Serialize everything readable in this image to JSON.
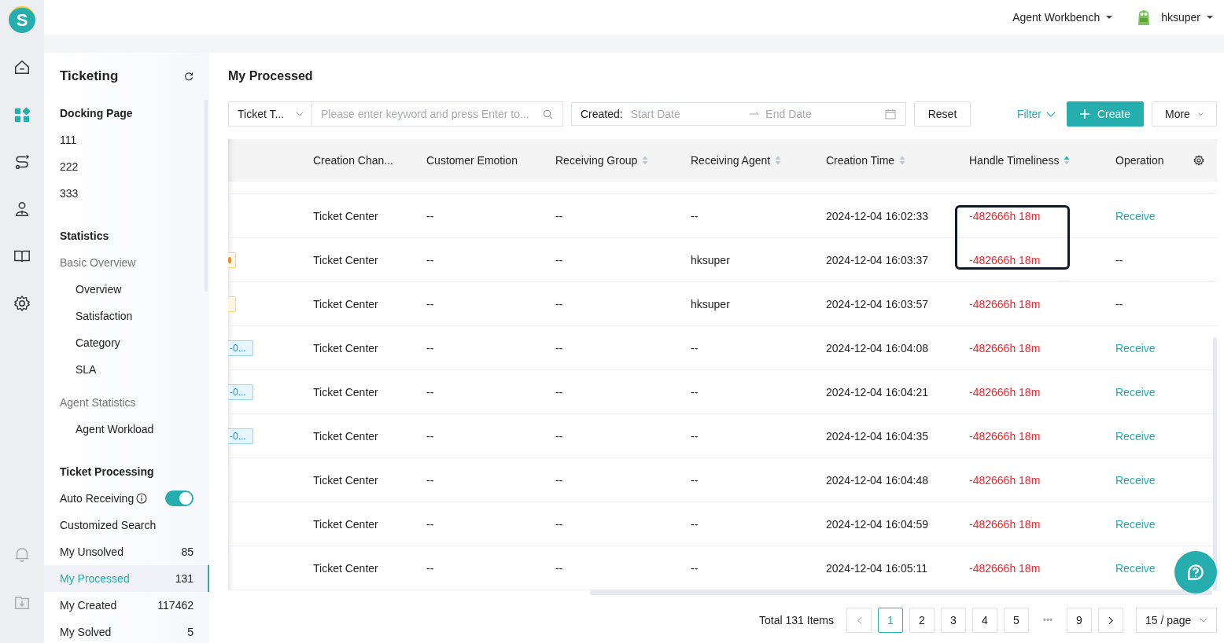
{
  "logo": "S",
  "rail": [
    {
      "kind": "home",
      "selected": false
    },
    {
      "kind": "grid",
      "selected": true
    },
    {
      "kind": "route",
      "selected": false
    },
    {
      "kind": "person",
      "selected": false
    },
    {
      "kind": "book",
      "selected": false
    },
    {
      "kind": "gear",
      "selected": false
    }
  ],
  "rail_bottom": [
    {
      "kind": "bell"
    },
    {
      "kind": "download"
    }
  ],
  "topbar": {
    "workspace": "Agent Workbench",
    "user": "hksuper"
  },
  "sidebar": {
    "title": "Ticketing",
    "sections": [
      {
        "heading": "Docking Page",
        "items": [
          {
            "label": "111",
            "kind": "item"
          },
          {
            "label": "222",
            "kind": "item"
          },
          {
            "label": "333",
            "kind": "item"
          }
        ]
      },
      {
        "heading": "Statistics",
        "items": [
          {
            "label": "Basic Overview",
            "kind": "group"
          },
          {
            "label": "Overview",
            "kind": "sub"
          },
          {
            "label": "Satisfaction",
            "kind": "sub"
          },
          {
            "label": "Category",
            "kind": "sub"
          },
          {
            "label": "SLA",
            "kind": "sub"
          },
          {
            "label": "Agent Statistics",
            "kind": "group"
          },
          {
            "label": "Agent Workload",
            "kind": "sub"
          }
        ]
      },
      {
        "heading": "Ticket Processing",
        "items": [
          {
            "label": "Auto Receiving",
            "kind": "toggle",
            "on": true
          },
          {
            "label": "Customized Search",
            "kind": "item"
          },
          {
            "label": "My Unsolved",
            "kind": "count",
            "count": "85",
            "selected": false
          },
          {
            "label": "My Processed",
            "kind": "count",
            "count": "131",
            "selected": true
          },
          {
            "label": "My Created",
            "kind": "count",
            "count": "117462",
            "selected": false
          },
          {
            "label": "My Solved",
            "kind": "count",
            "count": "5",
            "selected": false
          }
        ]
      }
    ]
  },
  "page_title": "My Processed",
  "filters": {
    "type_select": "Ticket T...",
    "search": {
      "placeholder": "Please enter keyword and press Enter to..."
    },
    "date_label": "Created:",
    "start_placeholder": "Start Date",
    "end_placeholder": "End Date",
    "reset": "Reset",
    "filter": "Filter",
    "create": "Create",
    "more": "More"
  },
  "table": {
    "columns": [
      {
        "label": "Creation Chan..."
      },
      {
        "label": "Customer Emotion"
      },
      {
        "label": "Receiving Group",
        "sortable": true,
        "sorted_ascending": false
      },
      {
        "label": "Receiving Agent",
        "sortable": true,
        "sorted_ascending": false
      },
      {
        "label": "Creation Time",
        "sortable": true,
        "sorted_ascending": false
      },
      {
        "label": "Handle Timeliness",
        "sortable": true,
        "sorted_ascending": true
      },
      {
        "label": "Operation"
      }
    ],
    "rows": [
      {
        "channel": "Ticket Center",
        "emotion": "--",
        "group": "--",
        "agent": "--",
        "time": "2024-12-04 16:02:33",
        "timeliness": "-482666h 18m",
        "operation": "Receive",
        "highlighted": true
      },
      {
        "tag": {
          "kind": "warning",
          "flag": true
        },
        "channel": "Ticket Center",
        "emotion": "--",
        "group": "--",
        "agent": "hksuper",
        "time": "2024-12-04 16:03:37",
        "timeliness": "-482666h 18m",
        "operation": "--",
        "highlighted": true
      },
      {
        "tag": {
          "kind": "warning",
          "flag": false
        },
        "channel": "Ticket Center",
        "emotion": "--",
        "group": "--",
        "agent": "hksuper",
        "time": "2024-12-04 16:03:57",
        "timeliness": "-482666h 18m",
        "operation": "--",
        "highlighted": false
      },
      {
        "tag": {
          "kind": "info",
          "text": "-0..."
        },
        "channel": "Ticket Center",
        "emotion": "--",
        "group": "--",
        "agent": "--",
        "time": "2024-12-04 16:04:08",
        "timeliness": "-482666h 18m",
        "operation": "Receive",
        "highlighted": false
      },
      {
        "tag": {
          "kind": "info",
          "text": "-0..."
        },
        "channel": "Ticket Center",
        "emotion": "--",
        "group": "--",
        "agent": "--",
        "time": "2024-12-04 16:04:21",
        "timeliness": "-482666h 18m",
        "operation": "Receive",
        "highlighted": false
      },
      {
        "tag": {
          "kind": "info",
          "text": "-0..."
        },
        "channel": "Ticket Center",
        "emotion": "--",
        "group": "--",
        "agent": "--",
        "time": "2024-12-04 16:04:35",
        "timeliness": "-482666h 18m",
        "operation": "Receive",
        "highlighted": false
      },
      {
        "channel": "Ticket Center",
        "emotion": "--",
        "group": "--",
        "agent": "--",
        "time": "2024-12-04 16:04:48",
        "timeliness": "-482666h 18m",
        "operation": "Receive",
        "highlighted": false
      },
      {
        "channel": "Ticket Center",
        "emotion": "--",
        "group": "--",
        "agent": "--",
        "time": "2024-12-04 16:04:59",
        "timeliness": "-482666h 18m",
        "operation": "Receive",
        "highlighted": false
      },
      {
        "channel": "Ticket Center",
        "emotion": "--",
        "group": "--",
        "agent": "--",
        "time": "2024-12-04 16:05:11",
        "timeliness": "-482666h 18m",
        "operation": "Receive",
        "highlighted": false
      }
    ]
  },
  "pagination": {
    "total": "Total 131 Items",
    "pages": [
      {
        "label": "1",
        "selected": true
      },
      {
        "label": "2",
        "selected": false
      },
      {
        "label": "3",
        "selected": false
      },
      {
        "label": "4",
        "selected": false
      },
      {
        "label": "5",
        "selected": false
      }
    ],
    "ellipsis": "•••",
    "last": "9",
    "page_size": "15 / page"
  }
}
